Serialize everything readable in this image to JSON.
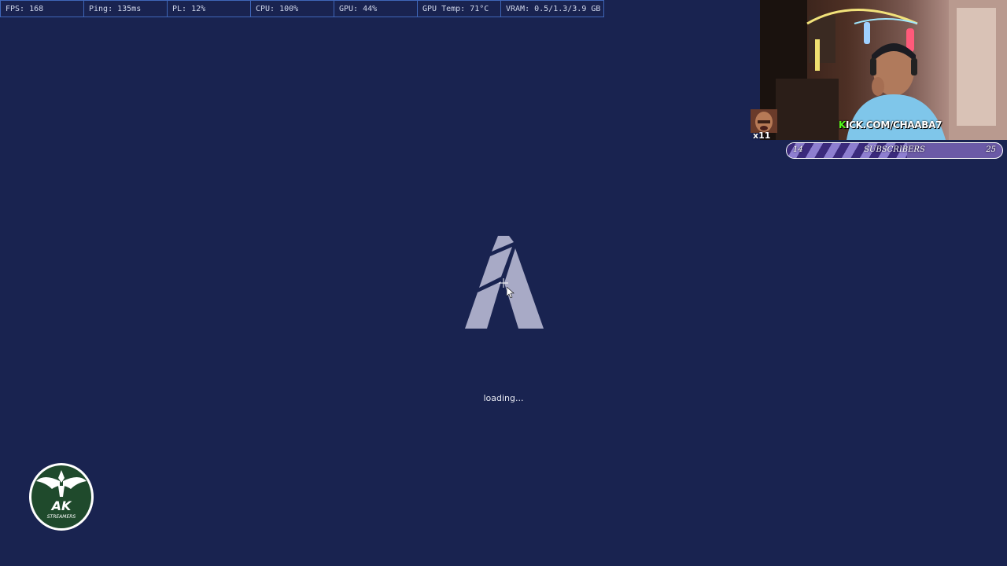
{
  "stats": [
    {
      "label": "FPS: 168"
    },
    {
      "label": "Ping: 135ms"
    },
    {
      "label": "PL: 12%"
    },
    {
      "label": "CPU: 100%"
    },
    {
      "label": "GPU: 44%"
    },
    {
      "label": "GPU Temp: 71°C"
    },
    {
      "label": "VRAM: 0.5/1.3/3.9 GB"
    }
  ],
  "loading": {
    "text": "loading..."
  },
  "stream": {
    "kick_k": "K",
    "kick_rest": "ICK.COM/CHAABA7",
    "emote_count": "x11"
  },
  "subscribers": {
    "current": "14",
    "label": "SUBSCRIBERS",
    "goal": "25",
    "progress": 0.56
  },
  "badge": {
    "title": "AK",
    "subtitle": "STREAMERS"
  },
  "colors": {
    "background": "#192350",
    "stat_border": "#3f66b8",
    "logo": "#a8aac6",
    "kick_green": "#53fc18",
    "badge_green": "#1f4a2c"
  }
}
